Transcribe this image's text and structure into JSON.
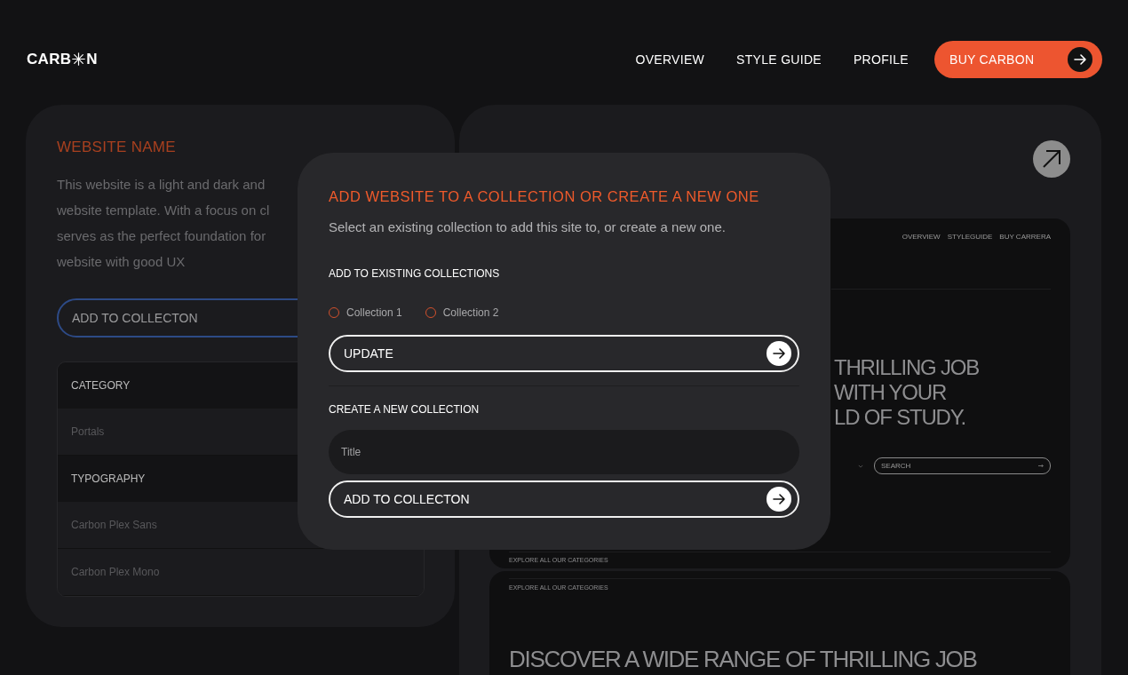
{
  "header": {
    "logo_start": "CARB",
    "logo_end": "N",
    "nav": [
      {
        "label": "OVERVIEW"
      },
      {
        "label": "STYLE GUIDE"
      },
      {
        "label": "PROFILE"
      }
    ],
    "cta": "BUY CARBON"
  },
  "website_card": {
    "title": "WEBSITE NAME",
    "description_lines": [
      "This website is a light and dark and",
      "website template. With a focus on cl",
      "serves as the perfect foundation for",
      "website with good UX"
    ],
    "add_button": "ADD TO COLLECTON",
    "details": [
      {
        "kind": "heading",
        "text": "CATEGORY"
      },
      {
        "kind": "value",
        "text": "Portals"
      },
      {
        "kind": "heading",
        "text": "TYPOGRAPHY"
      },
      {
        "kind": "value",
        "text": "Carbon Plex Sans"
      },
      {
        "kind": "value",
        "text": "Carbon Plex Mono"
      }
    ]
  },
  "preview_panel": {
    "screens": [
      {
        "nav": [
          "OVERVIEW",
          "STYLEGUIDE",
          "BUY CARRERA"
        ],
        "headline_lines": [
          "THRILLING JOB",
          "WITH YOUR",
          "LD OF STUDY."
        ],
        "search_placeholder": "SEARCH",
        "footer": "EXPLORE ALL OUR CATEGORIES"
      },
      {
        "label": "EXPLORE ALL OUR CATEGORIES",
        "headline_lines": [
          "DISCOVER A WIDE RANGE OF THRILLING JOB"
        ]
      }
    ]
  },
  "dialog": {
    "title": "ADD WEBSITE TO A COLLECTION OR CREATE A NEW ONE",
    "subtitle": "Select an existing collection to add this site to, or create a new one.",
    "existing_label": "ADD TO EXISTING COLLECTIONS",
    "collections": [
      {
        "label": "Collection 1",
        "selected": false
      },
      {
        "label": "Collection 2",
        "selected": false
      }
    ],
    "update_button": "UPDATE",
    "new_label": "CREATE A NEW COLLECTION",
    "title_field": {
      "placeholder": "Title"
    },
    "add_button": "ADD TO COLLECTON"
  }
}
